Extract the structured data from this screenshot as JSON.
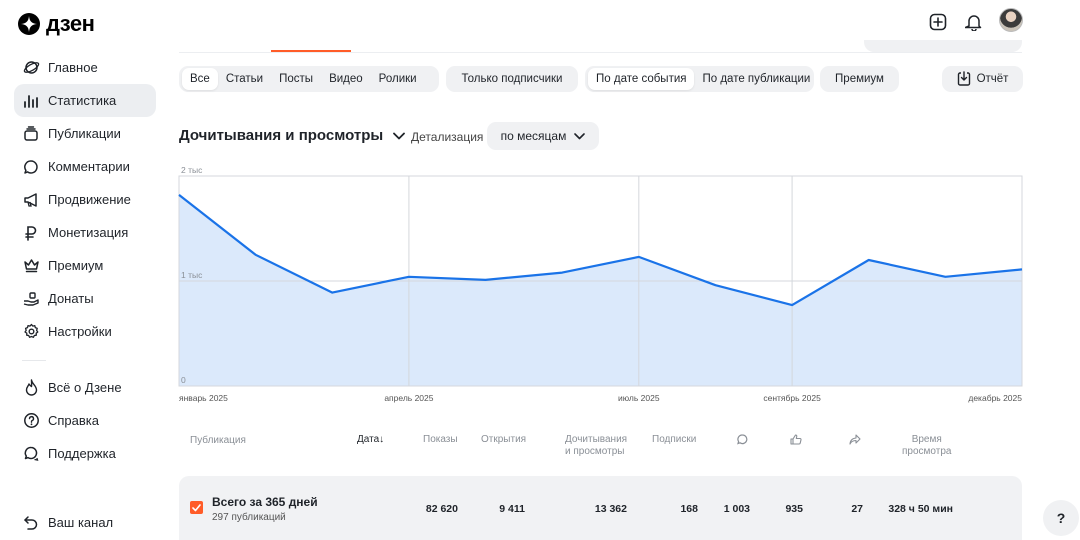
{
  "app": {
    "logo_text": "дзен"
  },
  "sidebar": {
    "items": [
      {
        "label": "Главное",
        "icon": "planet-icon"
      },
      {
        "label": "Статистика",
        "icon": "bar-chart-icon"
      },
      {
        "label": "Публикации",
        "icon": "publications-icon"
      },
      {
        "label": "Комментарии",
        "icon": "comment-icon"
      },
      {
        "label": "Продвижение",
        "icon": "megaphone-icon"
      },
      {
        "label": "Монетизация",
        "icon": "ruble-icon"
      },
      {
        "label": "Премиум",
        "icon": "crown-icon"
      },
      {
        "label": "Донаты",
        "icon": "donation-hand-icon"
      },
      {
        "label": "Настройки",
        "icon": "gear-icon"
      }
    ],
    "secondary": [
      {
        "label": "Всё о Дзене",
        "icon": "flame-icon"
      },
      {
        "label": "Справка",
        "icon": "question-circle-icon"
      },
      {
        "label": "Поддержка",
        "icon": "support-chat-icon"
      }
    ],
    "channel_label": "Ваш канал"
  },
  "filters": {
    "types": [
      "Все",
      "Статьи",
      "Посты",
      "Видео",
      "Ролики"
    ],
    "subscribers_only": "Только подписчики",
    "date_modes": [
      "По дате события",
      "По дате публикации"
    ],
    "premium": "Премиум",
    "report": "Отчёт"
  },
  "chart_header": {
    "title": "Дочитывания и просмотры",
    "detail_label": "Детализация",
    "period": "по месяцам"
  },
  "chart_data": {
    "type": "area",
    "y_ticks": [
      {
        "value": 0,
        "label": "0"
      },
      {
        "value": 1000,
        "label": "1 тыс"
      },
      {
        "value": 2000,
        "label": "2 тыс"
      }
    ],
    "ylim": [
      0,
      2000
    ],
    "x_ticks": [
      {
        "month": 0,
        "label": "январь 2025"
      },
      {
        "month": 3,
        "label": "апрель 2025"
      },
      {
        "month": 6,
        "label": "июль 2025"
      },
      {
        "month": 8,
        "label": "сентябрь 2025"
      },
      {
        "month": 11,
        "label": "декабрь 2025"
      }
    ],
    "xlim": [
      0,
      11
    ],
    "series": [
      {
        "x": [
          0,
          1,
          2,
          3,
          4,
          5,
          6,
          7,
          8,
          9,
          10,
          11
        ],
        "values": [
          1820,
          1250,
          890,
          1040,
          1010,
          1080,
          1230,
          960,
          770,
          1200,
          1040,
          1110
        ]
      }
    ],
    "line_color": "#1a73e8",
    "fill_color": "#dbe9fb",
    "grid": true
  },
  "table": {
    "headers": {
      "publication": "Публикация",
      "date": "Дата",
      "shows": "Показы",
      "opens": "Открытия",
      "reads_1": "Дочитывания",
      "reads_2": "и просмотры",
      "subs": "Подписки",
      "time_1": "Время",
      "time_2": "просмотра"
    },
    "header_icons": [
      "comment-icon",
      "like-icon",
      "share-icon"
    ],
    "summary": {
      "title": "Всего за 365 дней",
      "subtitle": "297 публикаций",
      "shows": "82 620",
      "opens": "9 411",
      "reads": "13 362",
      "subs": "168",
      "comments": "1 003",
      "likes": "935",
      "shares": "27",
      "time": "328 ч 50 мин"
    }
  },
  "help": {
    "label": "?"
  },
  "colors": {
    "accent": "#ff5c28",
    "chart_line": "#1a73e8"
  }
}
